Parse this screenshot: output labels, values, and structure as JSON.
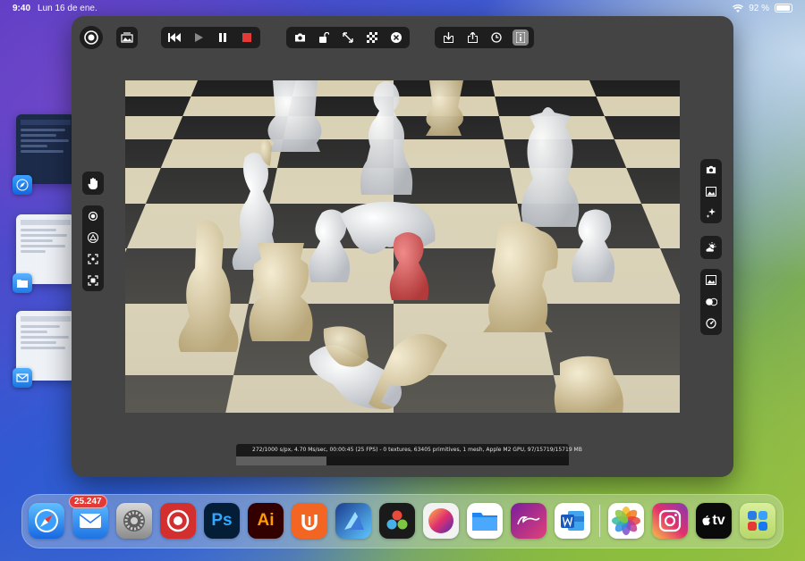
{
  "status_bar": {
    "time": "9:40",
    "date": "Lun 16 de ene.",
    "battery_percent": "92 %"
  },
  "render_stats": {
    "text": "272/1000 s/px, 4.70 Ms/sec, 00:00:45 (25 FPS) - 0 textures, 63405 primitives, 1 mesh, Apple M2 GPU, 97/15719/15719 MB",
    "progress_fraction": 0.272
  },
  "toolbar": {
    "playback": [
      "first-frame-icon",
      "play-icon",
      "pause-icon",
      "stop-icon"
    ],
    "view": [
      "camera-icon",
      "lock-icon",
      "expand-icon",
      "checkerboard-icon",
      "close-circle-icon"
    ],
    "file": [
      "import-icon",
      "export-icon",
      "clock-icon",
      "info-icon"
    ]
  },
  "dock": {
    "mail_badge": "25.247",
    "apps": [
      "Safari",
      "Mail",
      "Settings",
      "Procreate Dreams",
      "Photoshop",
      "Illustrator",
      "Ulysses",
      "Affinity Designer",
      "DaVinci Resolve",
      "Octane",
      "Files",
      "Fender",
      "Word",
      "Photos",
      "Instagram",
      "Apple TV",
      "Folder"
    ],
    "icon_labels": {
      "photoshop": "Ps",
      "illustrator": "Ai",
      "appletv": "tv"
    }
  },
  "colors": {
    "panel": "#444444",
    "toolbar": "#1e1e1e",
    "stop": "#e53935"
  }
}
